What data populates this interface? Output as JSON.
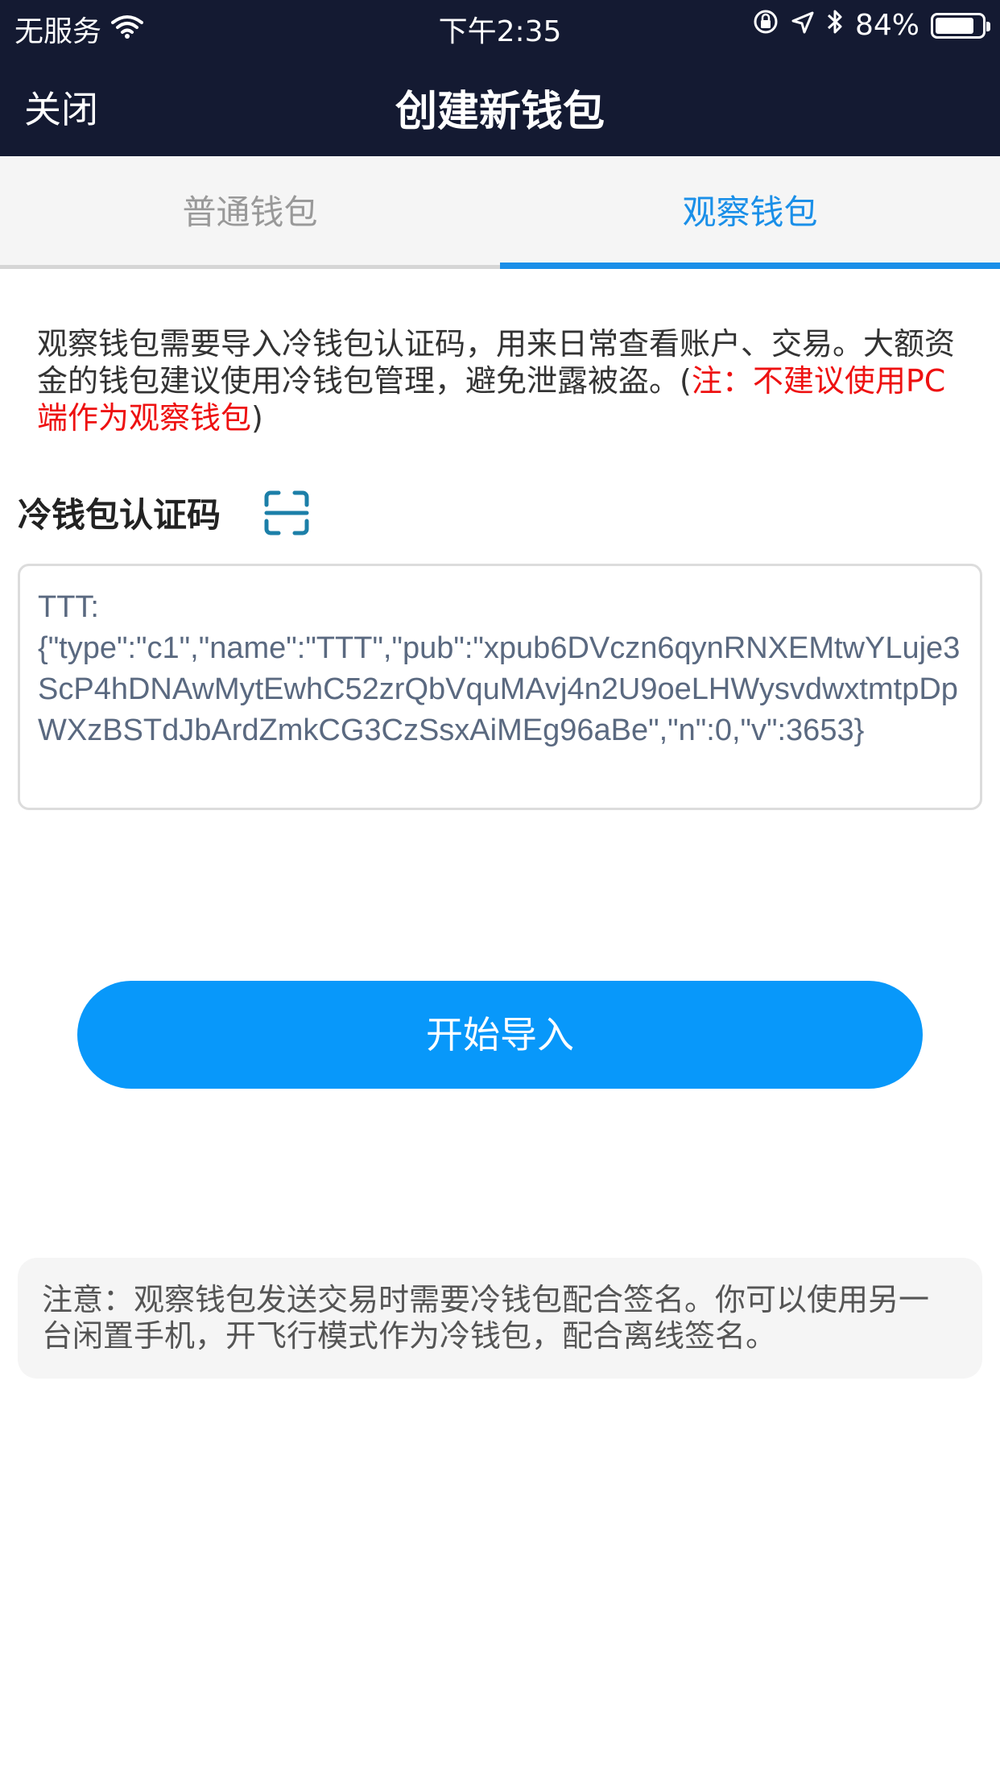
{
  "status_bar": {
    "carrier": "无服务",
    "time": "下午2:35",
    "battery_percent": "84%",
    "battery_level": 0.84,
    "icons": [
      "wifi-icon",
      "orientation-lock-icon",
      "location-icon",
      "bluetooth-icon",
      "battery-icon"
    ]
  },
  "nav": {
    "close_label": "关闭",
    "title": "创建新钱包"
  },
  "tabs": [
    {
      "label": "普通钱包",
      "active": false
    },
    {
      "label": "观察钱包",
      "active": true
    }
  ],
  "description": {
    "main": "观察钱包需要导入冷钱包认证码，用来日常查看账户、交易。大额资金的钱包建议使用冷钱包管理，避免泄露被盗。(",
    "warning": "注：不建议使用PC端作为观察钱包",
    "close_paren": ")"
  },
  "field": {
    "label": "冷钱包认证码",
    "scan_icon": "scan-icon",
    "value": "TTT:\n{\"type\":\"c1\",\"name\":\"TTT\",\"pub\":\"xpub6DVczn6qynRNXEMtwYLuje3ScP4hDNAwMytEwhC52zrQbVquMAvj4n2U9oeLHWysvdwxtmtpDpWXzBSTdJbArdZmkCG3CzSsxAiMEg96aBe\",\"n\":0,\"v\":3653}"
  },
  "import_button": "开始导入",
  "notice": "注意：观察钱包发送交易时需要冷钱包配合签名。你可以使用另一台闲置手机，开飞行模式作为冷钱包，配合离线签名。",
  "colors": {
    "header_bg": "#141a32",
    "accent": "#1a8fe8",
    "button_bg": "#0898fa",
    "warning": "#ee1111",
    "scan_icon": "#1c7fa8"
  }
}
